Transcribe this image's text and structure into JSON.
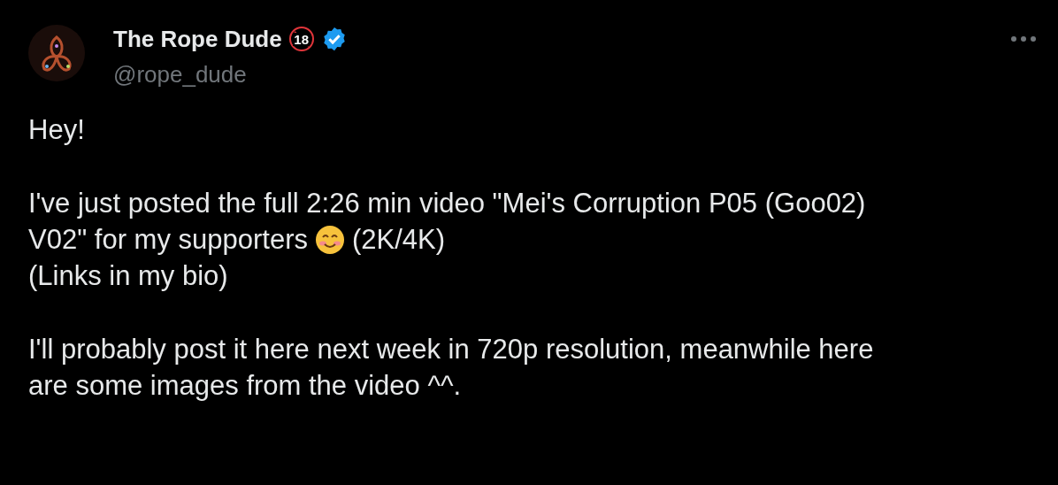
{
  "author": {
    "name": "The Rope Dude",
    "badge_text": "18",
    "verified": true,
    "handle": "@rope_dude"
  },
  "paragraphs": [
    {
      "lines": [
        [
          {
            "kind": "text",
            "text": "Hey!"
          }
        ]
      ]
    },
    {
      "lines": [
        [
          {
            "kind": "text",
            "text": "I've just posted the full 2:26 min video \"Mei's Corruption P05 (Goo02)"
          }
        ],
        [
          {
            "kind": "text",
            "text": "V02\" for my supporters"
          },
          {
            "kind": "emoji"
          },
          {
            "kind": "text",
            "text": "(2K/4K)"
          }
        ],
        [
          {
            "kind": "text",
            "text": "(Links in my bio)"
          }
        ]
      ]
    },
    {
      "lines": [
        [
          {
            "kind": "text",
            "text": "I'll probably post it here next week in 720p resolution, meanwhile here"
          }
        ],
        [
          {
            "kind": "text",
            "text": "are some images from the video ^^."
          }
        ]
      ]
    }
  ]
}
